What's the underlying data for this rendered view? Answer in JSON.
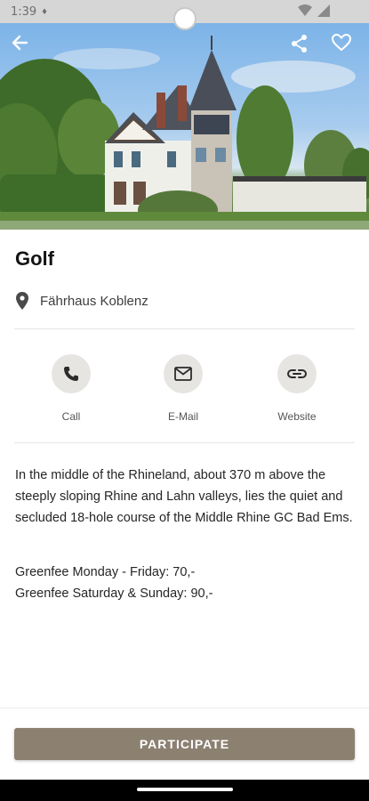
{
  "status_bar": {
    "time": "1:39"
  },
  "header": {
    "back_icon": "arrow-back-icon",
    "share_icon": "share-icon",
    "favorite_icon": "heart-outline-icon"
  },
  "event": {
    "title": "Golf",
    "location": "Fährhaus Koblenz"
  },
  "actions": [
    {
      "label": "Call",
      "icon": "phone-icon"
    },
    {
      "label": "E-Mail",
      "icon": "mail-icon"
    },
    {
      "label": "Website",
      "icon": "link-icon"
    }
  ],
  "description": "In the middle of the Rhineland, about 370 m above the steeply sloping Rhine and Lahn valleys, lies the quiet and secluded 18-hole course of the Middle Rhine GC Bad Ems.",
  "fees": {
    "weekday": "Greenfee Monday - Friday: 70,-",
    "weekend": "Greenfee Saturday & Sunday: 90,-"
  },
  "participate_label": "PARTICIPATE",
  "colors": {
    "accent": "#8c8071",
    "action_bg": "#e7e5e2"
  }
}
